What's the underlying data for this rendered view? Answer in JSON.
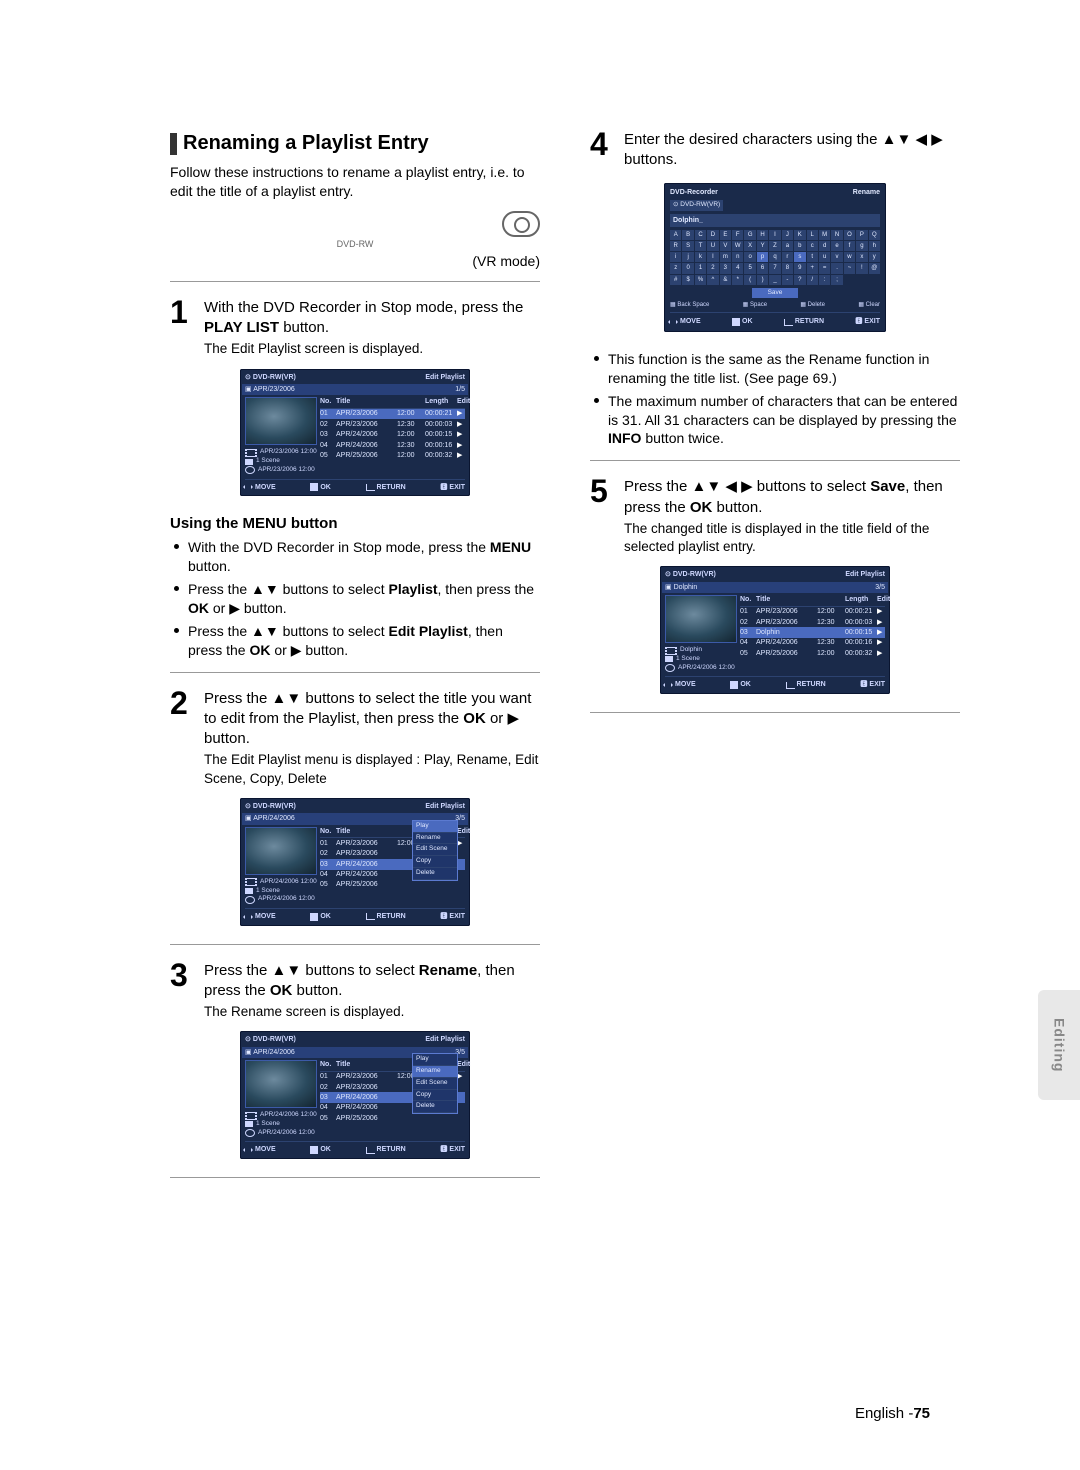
{
  "left": {
    "heading": "Renaming a Playlist Entry",
    "intro": "Follow these instructions to rename a playlist entry, i.e. to edit the title of a playlist entry.",
    "discLabel": "DVD-RW",
    "vrMode": "(VR mode)",
    "step1": {
      "num": "1",
      "main_a": "With the DVD Recorder in Stop mode, press the ",
      "bold": "PLAY LIST",
      "main_b": " button.",
      "sub": "The Edit Playlist screen is displayed."
    },
    "screen1": {
      "disc": "DVD-RW(VR)",
      "title": "Edit Playlist",
      "subLeft": "APR/23/2006",
      "subRight": "1/5",
      "cols": {
        "no": "No.",
        "title": "Title",
        "length": "Length",
        "edit": "Edit"
      },
      "rows": [
        {
          "no": "01",
          "title": "APR/23/2006",
          "time": "12:00",
          "len": "00:00:21"
        },
        {
          "no": "02",
          "title": "APR/23/2006",
          "time": "12:30",
          "len": "00:00:03"
        },
        {
          "no": "03",
          "title": "APR/24/2006",
          "time": "12:00",
          "len": "00:00:15"
        },
        {
          "no": "04",
          "title": "APR/24/2006",
          "time": "12:30",
          "len": "00:00:16"
        },
        {
          "no": "05",
          "title": "APR/25/2006",
          "time": "12:00",
          "len": "00:00:32"
        }
      ],
      "meta1": "APR/23/2006 12:00",
      "meta2": "1 Scene",
      "meta3": "APR/23/2006 12:00",
      "ft": {
        "move": "MOVE",
        "ok": "OK",
        "ret": "RETURN",
        "exit": "EXIT"
      }
    },
    "menuHeading": "Using the MENU button",
    "menuBullets": [
      {
        "a": "With the DVD Recorder in Stop mode, press the ",
        "b": "MENU",
        "c": " button."
      },
      {
        "a": "Press the ▲▼ buttons to select ",
        "b": "Playlist",
        "c": ", then press the ",
        "d": "OK",
        "e": " or ▶ button."
      },
      {
        "a": "Press the ▲▼ buttons to select ",
        "b": "Edit Playlist",
        "c": ", then press the ",
        "d": "OK",
        "e": " or ▶ button."
      }
    ],
    "step2": {
      "num": "2",
      "main": "Press the ▲▼ buttons to select the title you want to edit from the Playlist, then press the ",
      "bold": "OK",
      "main_b": " or ▶ button.",
      "sub": "The Edit Playlist menu is displayed : Play, Rename, Edit Scene, Copy, Delete"
    },
    "screen2": {
      "disc": "DVD-RW(VR)",
      "title": "Edit Playlist",
      "subLeft": "APR/24/2006",
      "subRight": "3/5",
      "meta1": "APR/24/2006 12:00",
      "meta2": "1 Scene",
      "meta3": "APR/24/2006 12:00",
      "popup": [
        "Play",
        "Rename",
        "Edit Scene",
        "Copy",
        "Delete"
      ],
      "popupSel": 0
    },
    "step3": {
      "num": "3",
      "main_a": "Press the ▲▼ buttons to select ",
      "bold1": "Rename",
      "main_b": ", then press the ",
      "bold2": "OK",
      "main_c": " button.",
      "sub": "The Rename screen is displayed."
    },
    "screen3": {
      "popupSel": 1
    }
  },
  "right": {
    "step4": {
      "num": "4",
      "main": "Enter the desired characters using the ▲▼ ◀ ▶ buttons."
    },
    "rename": {
      "hdr": "DVD-Recorder",
      "title": "Rename",
      "disc": "DVD-RW(VR)",
      "input": "Dolphin_",
      "rows": [
        "A B C D E F G H I J K L M N O P",
        "Q R S T U V W X Y Z a b c d e f g",
        "h i j k l m n o p q r s t u v w",
        "x y z 0 1 2 3 4 5 6 7 8 9 + = .",
        "~ ! @ # $ % ^ & * ( ) _ - ? / : ; "
      ],
      "selIndex": 10,
      "save": "Save",
      "legend": {
        "bs": "Back Space",
        "sp": "Space",
        "del": "Delete",
        "clr": "Clear"
      },
      "ft": {
        "move": "MOVE",
        "ok": "OK",
        "ret": "RETURN",
        "exit": "EXIT"
      }
    },
    "notes": [
      "This function is the same as the Rename function in renaming the title list. (See page 69.)",
      {
        "a": "The maximum number of characters that can be entered is 31. All 31 characters can be displayed by pressing the ",
        "b": "INFO",
        "c": " button twice."
      }
    ],
    "step5": {
      "num": "5",
      "main_a": "Press the ▲▼ ◀ ▶ buttons to select ",
      "bold1": "Save",
      "main_b": ", then press the ",
      "bold2": "OK",
      "main_c": " button.",
      "sub": "The changed title is displayed in the title field of the selected playlist entry."
    },
    "screen5": {
      "disc": "DVD-RW(VR)",
      "title": "Edit Playlist",
      "subLeft": "Dolphin",
      "subRight": "3/5",
      "rows": [
        {
          "no": "01",
          "title": "APR/23/2006",
          "time": "12:00",
          "len": "00:00:21"
        },
        {
          "no": "02",
          "title": "APR/23/2006",
          "time": "12:30",
          "len": "00:00:03"
        },
        {
          "no": "03",
          "title": "Dolphin",
          "time": "",
          "len": "00:00:15"
        },
        {
          "no": "04",
          "title": "APR/24/2006",
          "time": "12:30",
          "len": "00:00:16"
        },
        {
          "no": "05",
          "title": "APR/25/2006",
          "time": "12:00",
          "len": "00:00:32"
        }
      ],
      "meta1": "Dolphin",
      "meta2": "1 Scene",
      "meta3": "APR/24/2006 12:00"
    }
  },
  "sideTab": "Editing",
  "footer": {
    "lang": "English -",
    "page": "75"
  }
}
